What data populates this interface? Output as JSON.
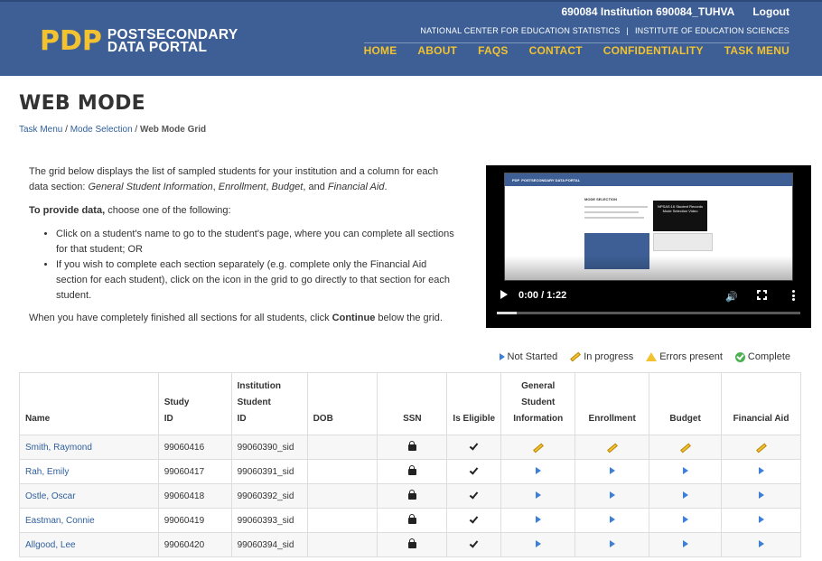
{
  "header": {
    "logo_mark": "PDP",
    "logo_line1": "POSTSECONDARY",
    "logo_line2": "DATA PORTAL",
    "user": "690084 Institution  690084_TUHVA",
    "logout": "Logout",
    "agency1": "NATIONAL CENTER FOR EDUCATION STATISTICS",
    "agency_sep": "|",
    "agency2": "INSTITUTE OF EDUCATION SCIENCES",
    "nav": [
      "HOME",
      "ABOUT",
      "FAQS",
      "CONTACT",
      "CONFIDENTIALITY",
      "TASK MENU"
    ]
  },
  "page": {
    "title": "WEB MODE",
    "breadcrumb": [
      "Task Menu",
      "Mode Selection",
      "Web Mode Grid"
    ],
    "breadcrumb_sep": "/"
  },
  "intro": {
    "p1_a": "The grid below displays the list of sampled students for your institution and a column for each data section: ",
    "p1_i1": "General Student Information",
    "p1_c1": ", ",
    "p1_i2": "Enrollment",
    "p1_c2": ", ",
    "p1_i3": "Budget",
    "p1_c3": ", and ",
    "p1_i4": "Financial Aid",
    "p1_end": ".",
    "p2_b": "To provide data,",
    "p2_rest": " choose one of the following:",
    "bullet1": "Click on a student's name to go to the student's page, where you can complete all sections for that student; OR",
    "bullet2": "If you wish to complete each section separately (e.g. complete only the Financial Aid section for each student), click on the icon in the grid to go directly to that section for each student.",
    "p3_a": "When you have completely finished all sections for all students, click ",
    "p3_b": "Continue",
    "p3_c": " below the grid."
  },
  "video": {
    "time": "0:00 / 1:22",
    "thumb_logo": "PDP",
    "thumb_logo_sub": "POSTSECONDARY DATA PORTAL",
    "thumb_title": "MODE SELECTION",
    "thumb_popup": "NPSAS:16 Student Records Mode Selection Video",
    "progress": 0.0
  },
  "legend": {
    "not_started": "Not Started",
    "in_progress": "In progress",
    "errors": "Errors present",
    "complete": "Complete"
  },
  "table": {
    "headers": [
      "Name",
      "Study ID",
      "Institution Student ID",
      "DOB",
      "SSN",
      "Is Eligible",
      "General Student Information",
      "Enrollment",
      "Budget",
      "Financial Aid"
    ],
    "rows": [
      {
        "name": "Smith, Raymond",
        "study_id": "99060416",
        "inst_id": "99060390_sid",
        "dob": "",
        "status": [
          "in-progress",
          "in-progress",
          "in-progress",
          "in-progress"
        ]
      },
      {
        "name": "Rah, Emily",
        "study_id": "99060417",
        "inst_id": "99060391_sid",
        "dob": "",
        "status": [
          "not-started",
          "not-started",
          "not-started",
          "not-started"
        ]
      },
      {
        "name": "Ostle, Oscar",
        "study_id": "99060418",
        "inst_id": "99060392_sid",
        "dob": "",
        "status": [
          "not-started",
          "not-started",
          "not-started",
          "not-started"
        ]
      },
      {
        "name": "Eastman, Connie",
        "study_id": "99060419",
        "inst_id": "99060393_sid",
        "dob": "",
        "status": [
          "not-started",
          "not-started",
          "not-started",
          "not-started"
        ]
      },
      {
        "name": "Allgood, Lee",
        "study_id": "99060420",
        "inst_id": "99060394_sid",
        "dob": "",
        "status": [
          "not-started",
          "not-started",
          "not-started",
          "not-started"
        ]
      }
    ]
  },
  "colors": {
    "header_bg": "#3d5f95",
    "accent_yellow": "#f2c230",
    "link_blue": "#2f5f9c",
    "status_blue": "#3d7fd6"
  }
}
